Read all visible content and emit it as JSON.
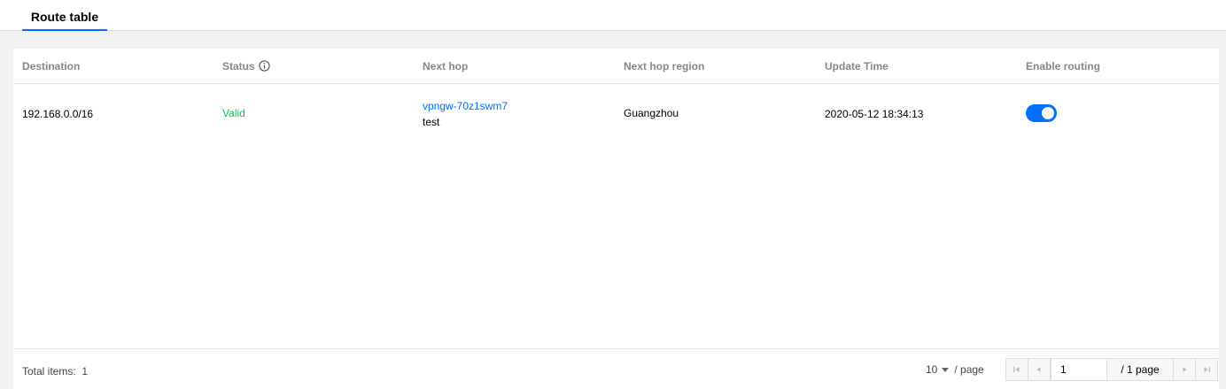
{
  "tabs": [
    {
      "label": "Route table"
    }
  ],
  "table": {
    "columns": [
      "Destination",
      "Status",
      "Next hop",
      "Next hop region",
      "Update Time",
      "Enable routing"
    ],
    "rows": [
      {
        "destination": "192.168.0.0/16",
        "status": "Valid",
        "next_hop_id": "vpngw-70z1swm7",
        "next_hop_name": "test",
        "next_hop_region": "Guangzhou",
        "update_time": "2020-05-12 18:34:13",
        "enabled": true
      }
    ]
  },
  "footer": {
    "total_label": "Total items:",
    "total_value": "1",
    "page_size": "10",
    "page_size_suffix": "/ page",
    "current_page": "1",
    "total_pages_label": "/ 1 page"
  },
  "colors": {
    "accent": "#006eff",
    "valid": "#0abf5b"
  },
  "icons": {
    "status_info": "info-circle-icon",
    "first_page": "first-page-icon",
    "prev_page": "prev-page-icon",
    "next_page": "next-page-icon",
    "last_page": "last-page-icon"
  }
}
